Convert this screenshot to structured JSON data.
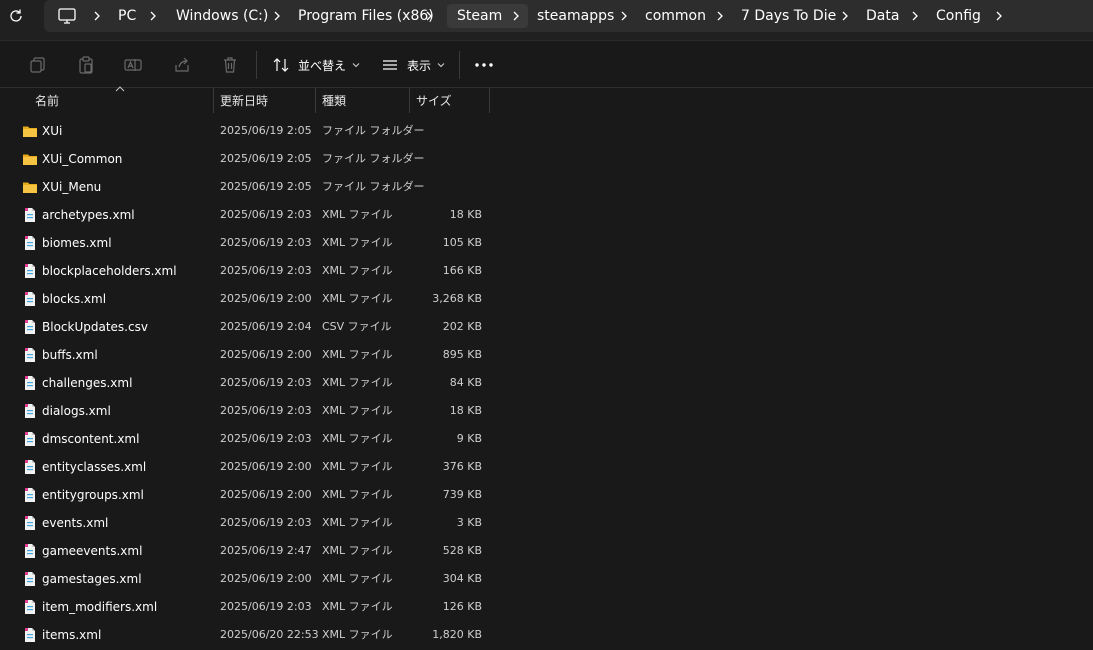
{
  "address_bar": {
    "breadcrumbs": [
      "PC",
      "Windows (C:)",
      "Program Files (x86)",
      "Steam",
      "steamapps",
      "common",
      "7 Days To Die",
      "Data",
      "Config"
    ]
  },
  "toolbar": {
    "sort_label": "並べ替え",
    "view_label": "表示",
    "more_label": "…"
  },
  "columns": {
    "name": "名前",
    "date": "更新日時",
    "type": "種類",
    "size": "サイズ"
  },
  "files": [
    {
      "icon": "folder-icon",
      "name": "XUi",
      "date": "2025/06/19 2:05",
      "type": "ファイル フォルダー",
      "size": ""
    },
    {
      "icon": "folder-icon",
      "name": "XUi_Common",
      "date": "2025/06/19 2:05",
      "type": "ファイル フォルダー",
      "size": ""
    },
    {
      "icon": "folder-icon",
      "name": "XUi_Menu",
      "date": "2025/06/19 2:05",
      "type": "ファイル フォルダー",
      "size": ""
    },
    {
      "icon": "xml-file-icon",
      "name": "archetypes.xml",
      "date": "2025/06/19 2:03",
      "type": "XML ファイル",
      "size": "18 KB"
    },
    {
      "icon": "xml-file-icon",
      "name": "biomes.xml",
      "date": "2025/06/19 2:03",
      "type": "XML ファイル",
      "size": "105 KB"
    },
    {
      "icon": "xml-file-icon",
      "name": "blockplaceholders.xml",
      "date": "2025/06/19 2:03",
      "type": "XML ファイル",
      "size": "166 KB"
    },
    {
      "icon": "xml-file-icon",
      "name": "blocks.xml",
      "date": "2025/06/19 2:00",
      "type": "XML ファイル",
      "size": "3,268 KB"
    },
    {
      "icon": "csv-file-icon",
      "name": "BlockUpdates.csv",
      "date": "2025/06/19 2:04",
      "type": "CSV ファイル",
      "size": "202 KB"
    },
    {
      "icon": "xml-file-icon",
      "name": "buffs.xml",
      "date": "2025/06/19 2:00",
      "type": "XML ファイル",
      "size": "895 KB"
    },
    {
      "icon": "xml-file-icon",
      "name": "challenges.xml",
      "date": "2025/06/19 2:03",
      "type": "XML ファイル",
      "size": "84 KB"
    },
    {
      "icon": "xml-file-icon",
      "name": "dialogs.xml",
      "date": "2025/06/19 2:03",
      "type": "XML ファイル",
      "size": "18 KB"
    },
    {
      "icon": "xml-file-icon",
      "name": "dmscontent.xml",
      "date": "2025/06/19 2:03",
      "type": "XML ファイル",
      "size": "9 KB"
    },
    {
      "icon": "xml-file-icon",
      "name": "entityclasses.xml",
      "date": "2025/06/19 2:00",
      "type": "XML ファイル",
      "size": "376 KB"
    },
    {
      "icon": "xml-file-icon",
      "name": "entitygroups.xml",
      "date": "2025/06/19 2:00",
      "type": "XML ファイル",
      "size": "739 KB"
    },
    {
      "icon": "xml-file-icon",
      "name": "events.xml",
      "date": "2025/06/19 2:03",
      "type": "XML ファイル",
      "size": "3 KB"
    },
    {
      "icon": "xml-file-icon",
      "name": "gameevents.xml",
      "date": "2025/06/19 2:47",
      "type": "XML ファイル",
      "size": "528 KB"
    },
    {
      "icon": "xml-file-icon",
      "name": "gamestages.xml",
      "date": "2025/06/19 2:00",
      "type": "XML ファイル",
      "size": "304 KB"
    },
    {
      "icon": "xml-file-icon",
      "name": "item_modifiers.xml",
      "date": "2025/06/19 2:03",
      "type": "XML ファイル",
      "size": "126 KB"
    },
    {
      "icon": "xml-file-icon",
      "name": "items.xml",
      "date": "2025/06/20 22:53",
      "type": "XML ファイル",
      "size": "1,820 KB"
    }
  ],
  "colors": {
    "background": "#191919",
    "address_bar": "#2d2d2d",
    "folder": "#f6c343",
    "file_accent": "#e03b8f"
  }
}
